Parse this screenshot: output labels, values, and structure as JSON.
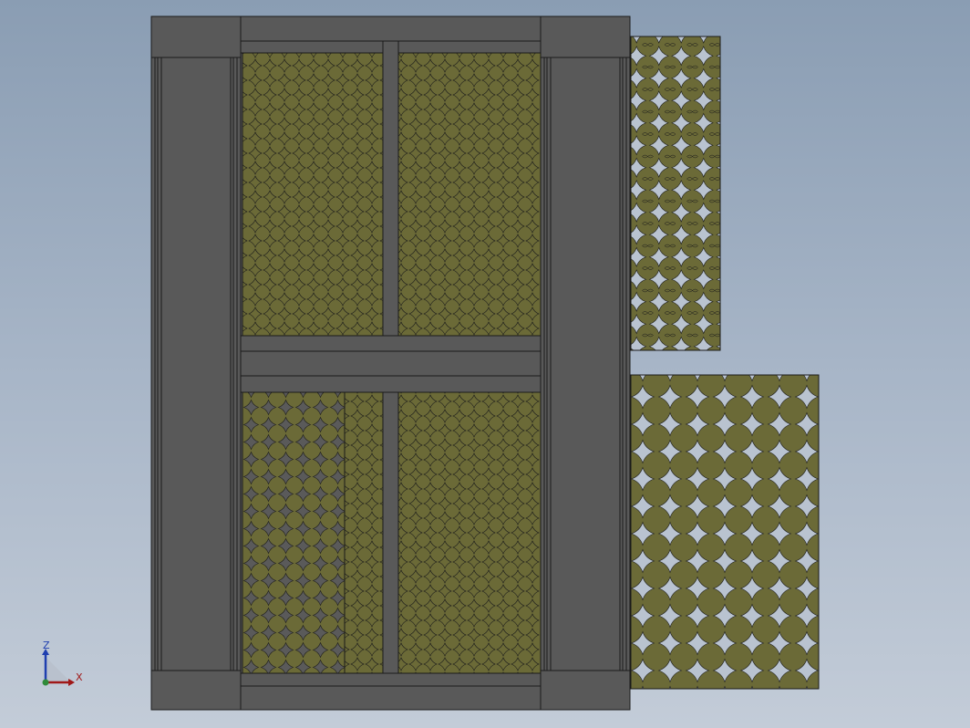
{
  "viewport": {
    "background_top": "#8a9db3",
    "background_bottom": "#c3ccd8"
  },
  "model": {
    "frame_color": "#595959",
    "frame_dark": "#4a4a4a",
    "edge_color": "#1a1a1a",
    "panel_color": "#6b6a37",
    "hole_color": "#b9c3d0"
  },
  "triad": {
    "z_label": "Z",
    "x_label": "X",
    "z_color": "#1f3fb0",
    "x_color": "#a01818",
    "origin_color": "#2f8a3a"
  }
}
